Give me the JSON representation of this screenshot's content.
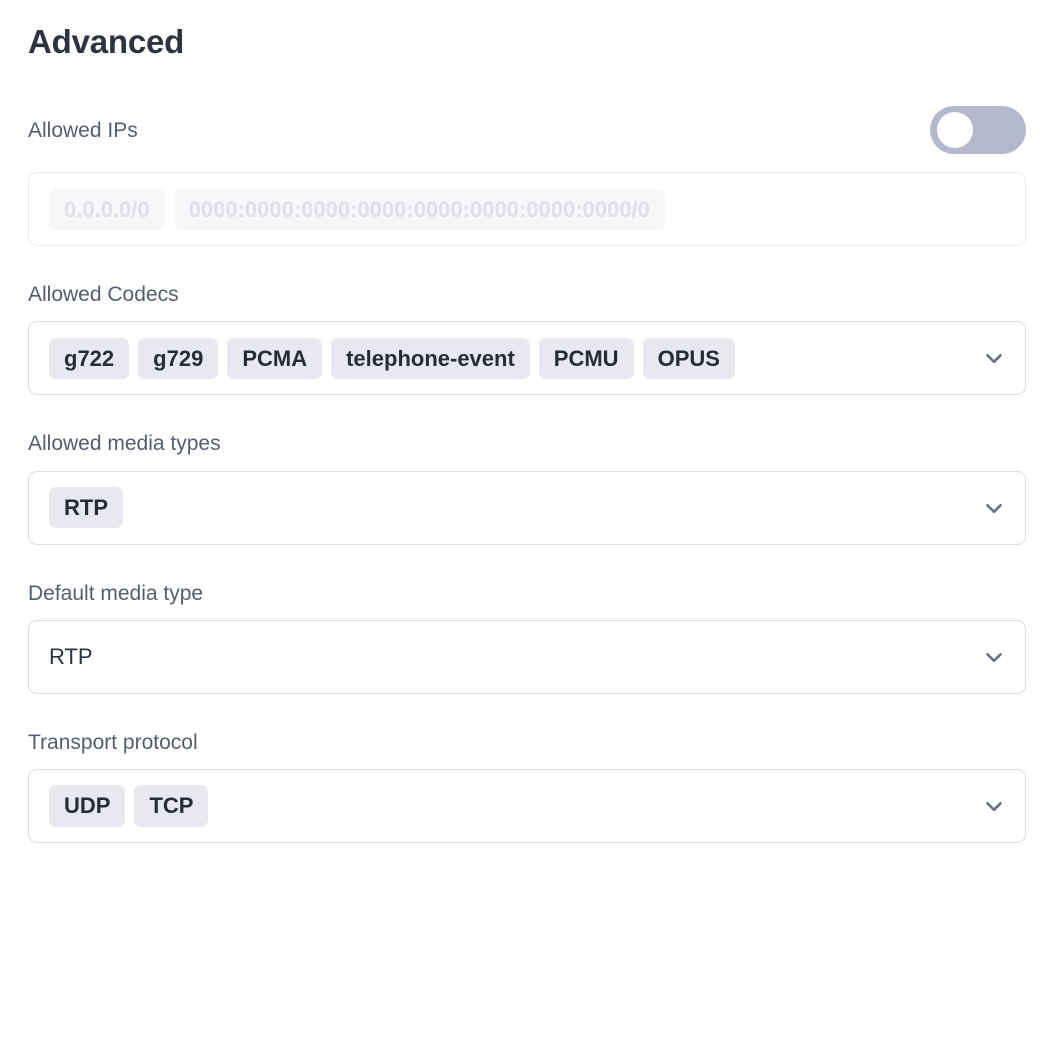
{
  "page": {
    "title": "Advanced"
  },
  "fields": {
    "allowed_ips": {
      "label": "Allowed IPs",
      "toggle": {
        "name": "allowed-ips-toggle",
        "state": "off"
      },
      "placeholders": [
        "0.0.0.0/0",
        "0000:0000:0000:0000:0000:0000:0000:0000/0"
      ]
    },
    "allowed_codecs": {
      "label": "Allowed Codecs",
      "values": [
        "g722",
        "g729",
        "PCMA",
        "telephone-event",
        "PCMU",
        "OPUS"
      ],
      "chevron_icon": "chevron-down-icon"
    },
    "allowed_media_types": {
      "label": "Allowed media types",
      "values": [
        "RTP"
      ],
      "chevron_icon": "chevron-down-icon"
    },
    "default_media_type": {
      "label": "Default media type",
      "value": "RTP",
      "chevron_icon": "chevron-down-icon"
    },
    "transport_protocol": {
      "label": "Transport protocol",
      "values": [
        "UDP",
        "TCP"
      ],
      "chevron_icon": "chevron-down-icon"
    }
  },
  "colors": {
    "title": "#2d3341",
    "label": "#555e70",
    "chip_bg": "#e8e8f0",
    "chip_text": "#262c38",
    "border": "#dcdce8",
    "border_disabled": "#e8e8ee",
    "toggle_track_off": "#b4b8cc",
    "toggle_knob": "#ffffff",
    "placeholder_text": "#dfe0e6",
    "chevron": "#6b7186"
  }
}
